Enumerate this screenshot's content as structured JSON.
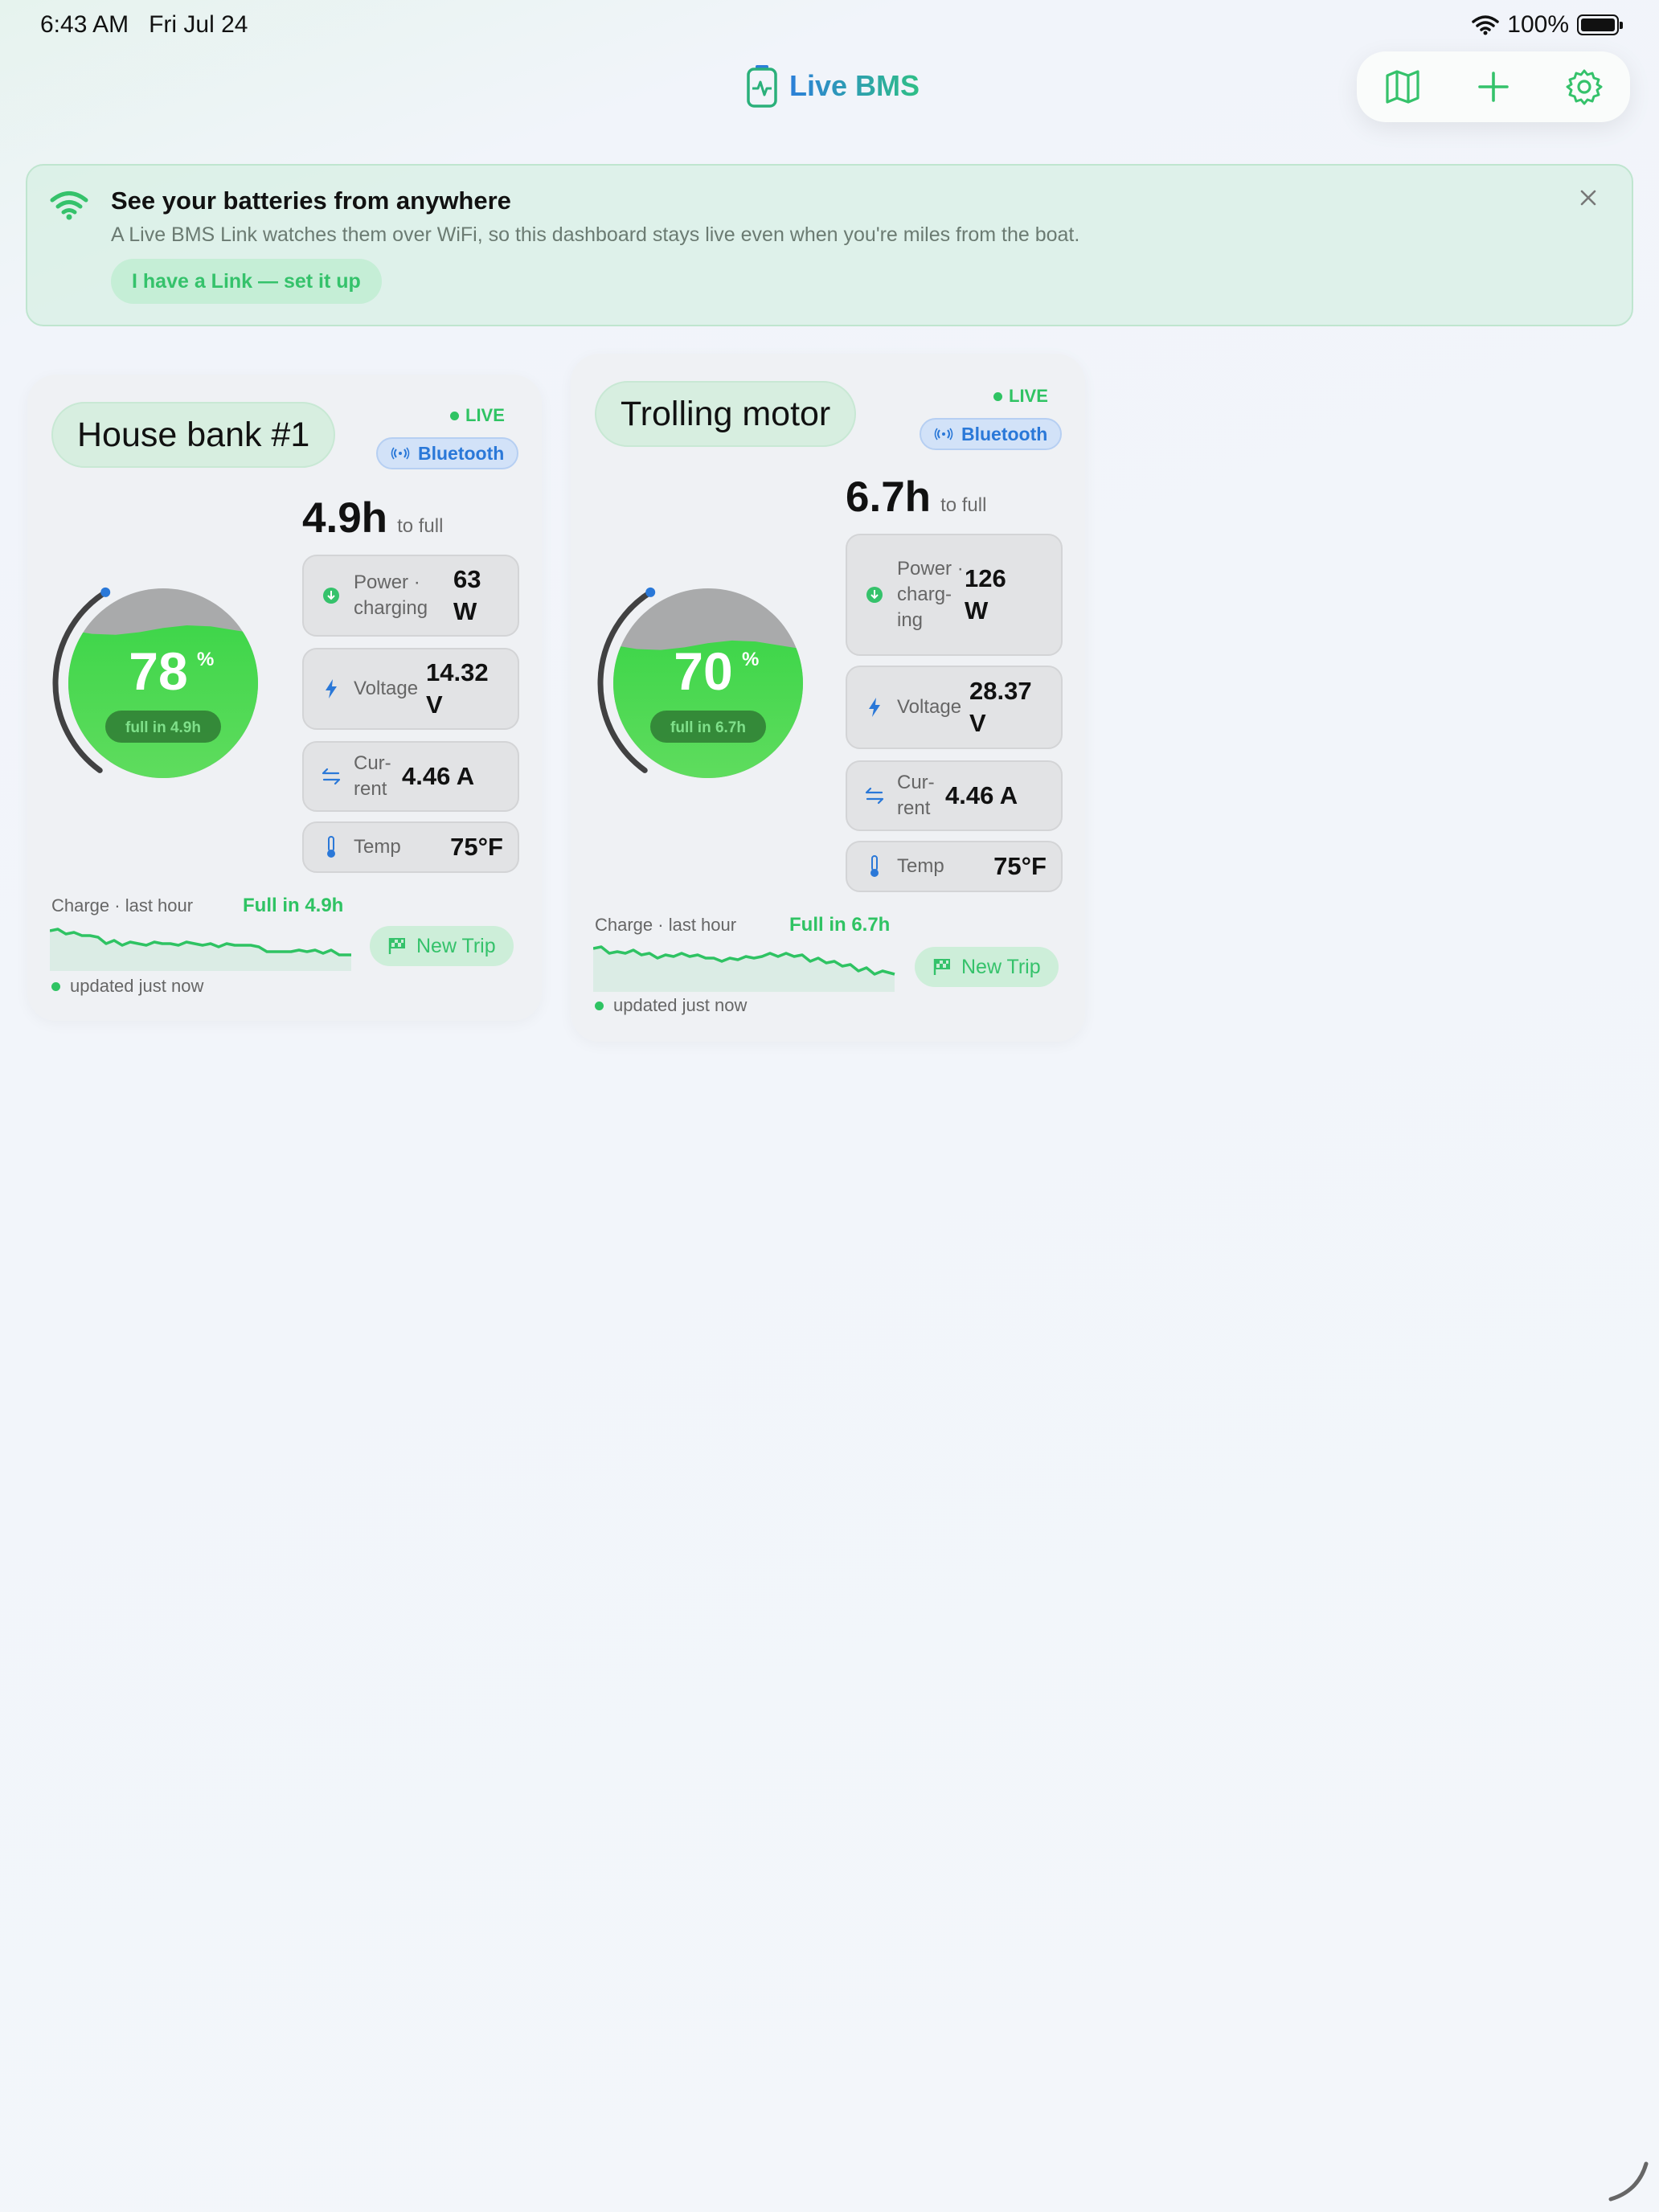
{
  "status_bar": {
    "time": "6:43 AM",
    "date": "Fri Jul 24",
    "battery": "100%"
  },
  "header": {
    "title": "Live BMS",
    "icons": [
      "map-icon",
      "plus-icon",
      "gear-icon"
    ]
  },
  "banner": {
    "title": "See your batteries from anywhere",
    "subtitle": "A Live BMS Link watches them over WiFi, so this dashboard stays live even when you're miles from the boat.",
    "button": "I have a Link — set it up",
    "icons": [
      "wifi-icon",
      "close-icon"
    ]
  },
  "colors": {
    "accent_green": "#2fc363",
    "bluetooth_blue": "#2a78d8",
    "gauge_fill": "#3fd64a"
  },
  "cards": [
    {
      "name": "House bank #1",
      "live": "LIVE",
      "connection": "Bluetooth",
      "hours": "4.9h",
      "hours_suffix": "to full",
      "soc_value": "78",
      "soc_unit": "%",
      "soc_fraction": 0.78,
      "full_pill": "full in 4.9h",
      "metrics": [
        {
          "icon": "charging-arrow-icon",
          "label": "Power · charging",
          "value": "63 W"
        },
        {
          "icon": "bolt-icon",
          "label": "Volt­age",
          "value": "14.32 V"
        },
        {
          "icon": "arrows-swap-icon",
          "label": "Cur­rent",
          "value": "4.46 A"
        },
        {
          "icon": "thermometer-icon",
          "label": "Temp",
          "value": "75°F"
        }
      ],
      "chart_label": "Charge · last hour",
      "chart_full": "Full in 4.9h",
      "trip_button": "New Trip",
      "updated": "updated just now"
    },
    {
      "name": "Trolling motor",
      "live": "LIVE",
      "connection": "Bluetooth",
      "hours": "6.7h",
      "hours_suffix": "to full",
      "soc_value": "70",
      "soc_unit": "%",
      "soc_fraction": 0.7,
      "full_pill": "full in 6.7h",
      "metrics": [
        {
          "icon": "charging-arrow-icon",
          "label": "Power · charg­ing",
          "value": "126 W"
        },
        {
          "icon": "bolt-icon",
          "label": "Volt­age",
          "value": "28.37 V"
        },
        {
          "icon": "arrows-swap-icon",
          "label": "Cur­rent",
          "value": "4.46 A"
        },
        {
          "icon": "thermometer-icon",
          "label": "Temp",
          "value": "75°F"
        }
      ],
      "chart_label": "Charge · last hour",
      "chart_full": "Full in 6.7h",
      "trip_button": "New Trip",
      "updated": "updated just now"
    }
  ]
}
